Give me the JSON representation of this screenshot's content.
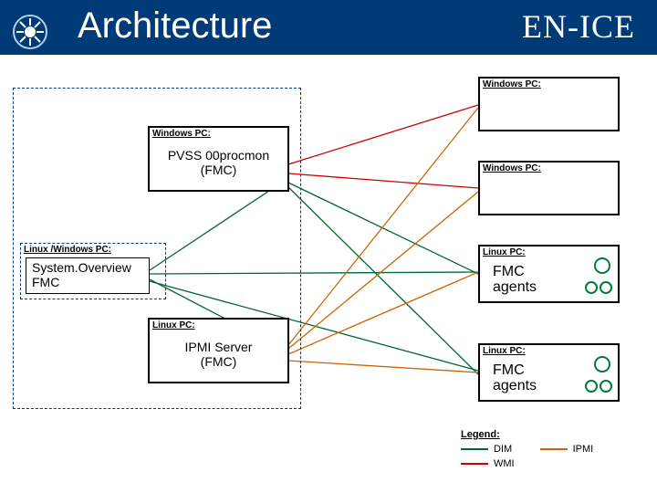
{
  "header": {
    "title": "Architecture",
    "brand": "EN-ICE"
  },
  "labels": {
    "windows_pc": "Windows PC:",
    "linux_windows_pc": "Linux /Windows PC:",
    "linux_pc": "Linux PC:"
  },
  "nodes": {
    "procmon": {
      "line1": "PVSS 00procmon",
      "line2": "(FMC)"
    },
    "system_overview": {
      "line1": "System.Overview",
      "line2": "FMC"
    },
    "ipmi_server": {
      "line1": "IPMI Server",
      "line2": "(FMC)"
    },
    "fmc_agents": "FMC\nagents"
  },
  "legend": {
    "title": "Legend:",
    "dim": "DIM",
    "wmi": "WMI",
    "ipmi": "IPMI"
  },
  "colors": {
    "dim": "#006633",
    "wmi": "#cc0000",
    "ipmi": "#cc6600",
    "agent": "#007a3d"
  }
}
